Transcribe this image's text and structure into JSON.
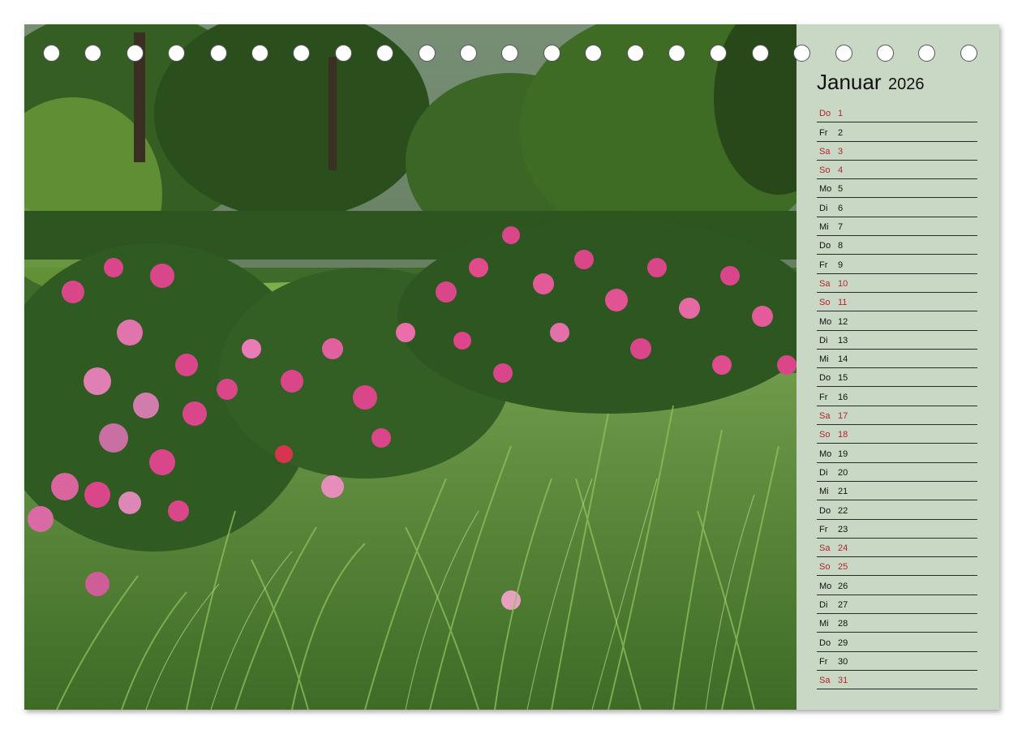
{
  "calendar": {
    "month": "Januar",
    "year": "2026",
    "weekend_color": "#b3242f",
    "panel_color": "#c9d7c5",
    "days": [
      {
        "weekday": "Do",
        "day": "1",
        "holiday": true
      },
      {
        "weekday": "Fr",
        "day": "2",
        "holiday": false
      },
      {
        "weekday": "Sa",
        "day": "3",
        "holiday": true
      },
      {
        "weekday": "So",
        "day": "4",
        "holiday": true
      },
      {
        "weekday": "Mo",
        "day": "5",
        "holiday": false
      },
      {
        "weekday": "Di",
        "day": "6",
        "holiday": false
      },
      {
        "weekday": "Mi",
        "day": "7",
        "holiday": false
      },
      {
        "weekday": "Do",
        "day": "8",
        "holiday": false
      },
      {
        "weekday": "Fr",
        "day": "9",
        "holiday": false
      },
      {
        "weekday": "Sa",
        "day": "10",
        "holiday": true
      },
      {
        "weekday": "So",
        "day": "11",
        "holiday": true
      },
      {
        "weekday": "Mo",
        "day": "12",
        "holiday": false
      },
      {
        "weekday": "Di",
        "day": "13",
        "holiday": false
      },
      {
        "weekday": "Mi",
        "day": "14",
        "holiday": false
      },
      {
        "weekday": "Do",
        "day": "15",
        "holiday": false
      },
      {
        "weekday": "Fr",
        "day": "16",
        "holiday": false
      },
      {
        "weekday": "Sa",
        "day": "17",
        "holiday": true
      },
      {
        "weekday": "So",
        "day": "18",
        "holiday": true
      },
      {
        "weekday": "Mo",
        "day": "19",
        "holiday": false
      },
      {
        "weekday": "Di",
        "day": "20",
        "holiday": false
      },
      {
        "weekday": "Mi",
        "day": "21",
        "holiday": false
      },
      {
        "weekday": "Do",
        "day": "22",
        "holiday": false
      },
      {
        "weekday": "Fr",
        "day": "23",
        "holiday": false
      },
      {
        "weekday": "Sa",
        "day": "24",
        "holiday": true
      },
      {
        "weekday": "So",
        "day": "25",
        "holiday": true
      },
      {
        "weekday": "Mo",
        "day": "26",
        "holiday": false
      },
      {
        "weekday": "Di",
        "day": "27",
        "holiday": false
      },
      {
        "weekday": "Mi",
        "day": "28",
        "holiday": false
      },
      {
        "weekday": "Do",
        "day": "29",
        "holiday": false
      },
      {
        "weekday": "Fr",
        "day": "30",
        "holiday": false
      },
      {
        "weekday": "Sa",
        "day": "31",
        "holiday": true
      }
    ]
  },
  "photo": {
    "subject": "rose-garden-photo"
  }
}
